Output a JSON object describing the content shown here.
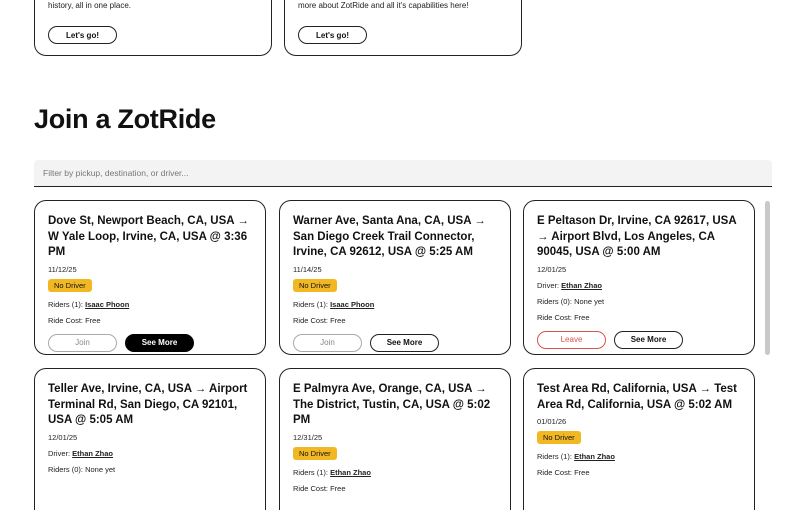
{
  "top_cards": [
    {
      "desc": "history, all in one place.",
      "button": "Let's go!"
    },
    {
      "desc": "more about ZotRide and all it's capabilities here!",
      "button": "Let's go!"
    }
  ],
  "page_title": "Join a ZotRide",
  "filter": {
    "placeholder": "Filter by pickup, destination, or driver..."
  },
  "rides": [
    {
      "route": "Dove St, Newport Beach, CA, USA → W Yale Loop, Irvine, CA, USA @ 3:36 PM",
      "date": "11/12/25",
      "badge": "No Driver",
      "riders_label": "Riders (1): ",
      "riders_name": "Isaac Phoon",
      "cost": "Ride Cost: Free",
      "action": "Join",
      "more": "See More"
    },
    {
      "route": "Warner Ave, Santa Ana, CA, USA → San Diego Creek Trail Connector, Irvine, CA 92612, USA @ 5:25 AM",
      "date": "11/14/25",
      "badge": "No Driver",
      "riders_label": "Riders (1): ",
      "riders_name": "Isaac Phoon",
      "cost": "Ride Cost: Free",
      "action": "Join",
      "more": "See More"
    },
    {
      "route": "E Peltason Dr, Irvine, CA 92617, USA → Airport Blvd, Los Angeles, CA 90045, USA @ 5:00 AM",
      "date": "12/01/25",
      "driver_label": "Driver: ",
      "driver_name": "Ethan Zhao",
      "riders": "Riders (0): None yet",
      "cost": "Ride Cost: Free",
      "action": "Leave",
      "more": "See More"
    },
    {
      "route": "Teller Ave, Irvine, CA, USA → Airport Terminal Rd, San Diego, CA 92101, USA @ 5:05 AM",
      "date": "12/01/25",
      "driver_label": "Driver: ",
      "driver_name": "Ethan Zhao",
      "riders": "Riders (0): None yet"
    },
    {
      "route": "E Palmyra Ave, Orange, CA, USA → The District, Tustin, CA, USA @ 5:02 PM",
      "date": "12/31/25",
      "badge": "No Driver",
      "riders_label": "Riders (1): ",
      "riders_name": "Ethan Zhao",
      "cost": "Ride Cost: Free"
    },
    {
      "route": "Test Area Rd, California, USA → Test Area Rd, California, USA @ 5:02 AM",
      "date": "01/01/26",
      "badge": "No Driver",
      "riders_label": "Riders (1): ",
      "riders_name": "Ethan Zhao",
      "cost": "Ride Cost: Free"
    }
  ]
}
